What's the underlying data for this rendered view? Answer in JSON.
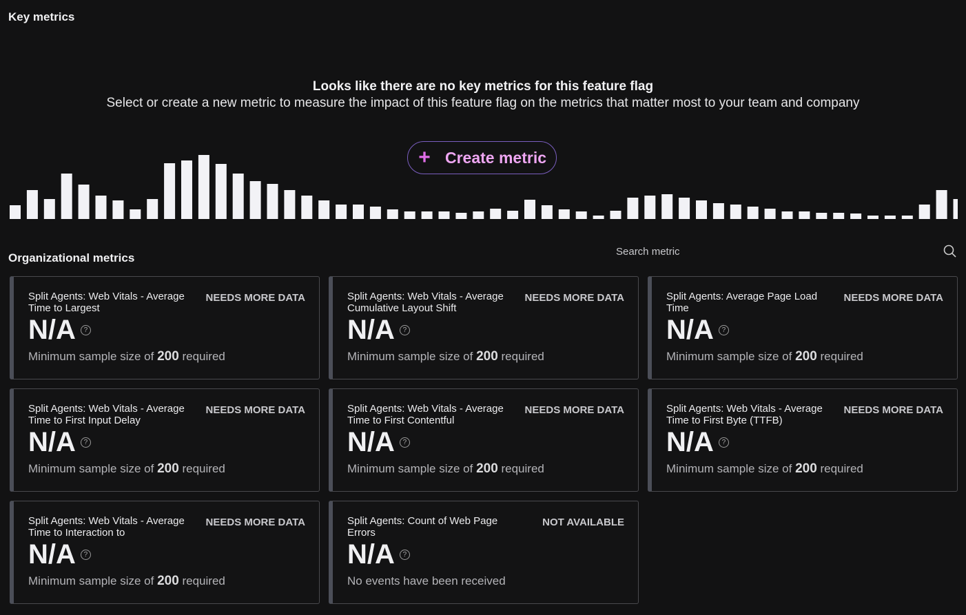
{
  "header": {
    "title": "Key metrics"
  },
  "empty_state": {
    "heading": "Looks like there are no key metrics for this feature flag",
    "body": "Select or create a new metric to measure the impact of this feature flag on the metrics that matter most to your team and company",
    "create_label": "Create metric",
    "plus_icon": "plus-icon"
  },
  "colors": {
    "accent": "#e06ee8",
    "button_border": "#7a5ec0",
    "background": "#121213",
    "bars": "#f2f2f6"
  },
  "org": {
    "title": "Organizational metrics",
    "search_placeholder": "Search metric",
    "search_icon": "search-icon"
  },
  "cards": [
    {
      "name": "Split Agents: Web Vitals - Average Time to Largest",
      "status": "NEEDS MORE DATA",
      "value": "N/A",
      "desc_pre": "Minimum sample size of ",
      "desc_num": "200",
      "desc_post": " required"
    },
    {
      "name": "Split Agents: Web Vitals - Average Cumulative Layout Shift",
      "status": "NEEDS MORE DATA",
      "value": "N/A",
      "desc_pre": "Minimum sample size of ",
      "desc_num": "200",
      "desc_post": " required"
    },
    {
      "name": "Split Agents: Average Page Load Time",
      "status": "NEEDS MORE DATA",
      "value": "N/A",
      "desc_pre": "Minimum sample size of ",
      "desc_num": "200",
      "desc_post": " required"
    },
    {
      "name": "Split Agents: Web Vitals - Average Time to First Input Delay",
      "status": "NEEDS MORE DATA",
      "value": "N/A",
      "desc_pre": "Minimum sample size of ",
      "desc_num": "200",
      "desc_post": " required"
    },
    {
      "name": "Split Agents: Web Vitals - Average Time to First Contentful",
      "status": "NEEDS MORE DATA",
      "value": "N/A",
      "desc_pre": "Minimum sample size of ",
      "desc_num": "200",
      "desc_post": " required"
    },
    {
      "name": "Split Agents: Web Vitals - Average Time to First Byte (TTFB)",
      "status": "NEEDS MORE DATA",
      "value": "N/A",
      "desc_pre": "Minimum sample size of ",
      "desc_num": "200",
      "desc_post": " required"
    },
    {
      "name": "Split Agents: Web Vitals - Average Time to Interaction to",
      "status": "NEEDS MORE DATA",
      "value": "N/A",
      "desc_pre": "Minimum sample size of ",
      "desc_num": "200",
      "desc_post": " required"
    },
    {
      "name": "Split Agents: Count of Web Page Errors",
      "status": "NOT AVAILABLE",
      "value": "N/A",
      "desc_pre": "No events have been received",
      "desc_num": "",
      "desc_post": ""
    }
  ]
}
